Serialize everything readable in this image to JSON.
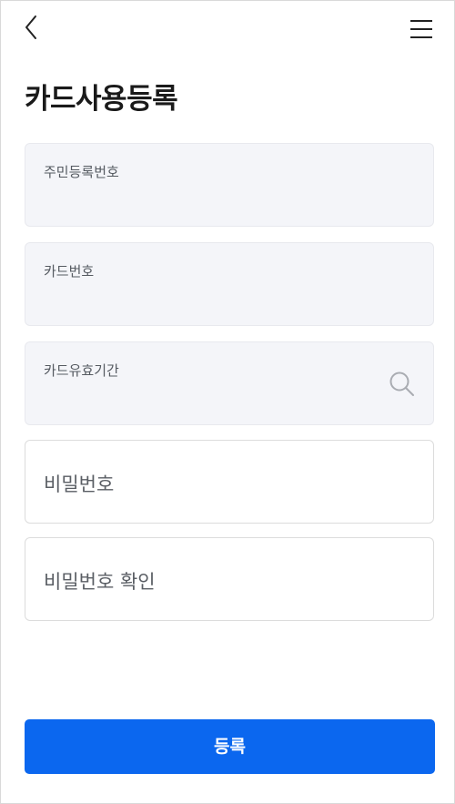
{
  "header": {
    "back_icon": "chevron-left-icon",
    "menu_icon": "hamburger-menu-icon"
  },
  "page": {
    "title": "카드사용등록"
  },
  "form": {
    "resident_number_label": "주민등록번호",
    "card_number_label": "카드번호",
    "card_expiry_label": "카드유효기간",
    "card_expiry_icon": "search-icon",
    "password_placeholder": "비밀번호",
    "password_confirm_placeholder": "비밀번호 확인"
  },
  "actions": {
    "submit_label": "등록"
  },
  "colors": {
    "accent": "#0b67ef",
    "field_fill": "#f4f5f9",
    "field_border": "#dcdcdc"
  }
}
